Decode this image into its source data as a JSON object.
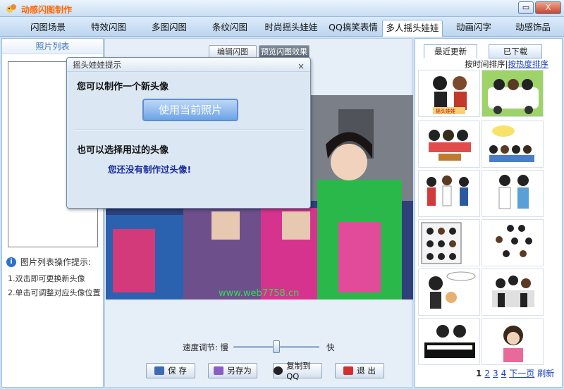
{
  "window": {
    "title": "动感闪图制作",
    "minimize_glyph": "▭",
    "close_glyph": "X"
  },
  "tabs": [
    {
      "label": "闪图场景"
    },
    {
      "label": "特效闪图"
    },
    {
      "label": "多图闪图"
    },
    {
      "label": "条纹闪图"
    },
    {
      "label": "时尚摇头娃娃"
    },
    {
      "label": "QQ搞笑表情"
    },
    {
      "label": "多人摇头娃娃"
    },
    {
      "label": "动画闪字"
    },
    {
      "label": "动感饰品"
    }
  ],
  "left_panel": {
    "header": "照片列表",
    "hint_title": "图片列表操作提示:",
    "hints": [
      "1.双击即可更换新头像",
      "2.单击可调整对应头像位置"
    ]
  },
  "center": {
    "subtabs": [
      {
        "label": "编辑闪图"
      },
      {
        "label": "预览闪图效果"
      }
    ],
    "watermark": "www.web7758.cn",
    "speed_label": "速度调节: 慢",
    "speed_fast": "快",
    "speed_value_percent": 50,
    "buttons": [
      {
        "label": "保 存"
      },
      {
        "label": "另存为"
      },
      {
        "label": "复制到QQ"
      },
      {
        "label": "退 出"
      }
    ]
  },
  "dialog": {
    "title": "摇头娃娃提示",
    "close_glyph": "×",
    "text1": "您可以制作一个新头像",
    "button": "使用当前照片",
    "text2": "也可以选择用过的头像",
    "text3": "您还没有制作过头像!"
  },
  "right_panel": {
    "tabs": [
      {
        "label": "最近更新"
      },
      {
        "label": "已下载"
      }
    ],
    "sort_time": "按时间排序|",
    "sort_hot": "按热度排序",
    "thumb_caption_1": "摇头娃娃",
    "pager": {
      "current": "1",
      "pages": [
        "2",
        "3",
        "4"
      ],
      "next": "下一页",
      "refresh": "刷新"
    }
  },
  "colors": {
    "accent": "#3a76c0",
    "title_text": "#ff6600",
    "dialog_text": "#1a2d9c"
  }
}
